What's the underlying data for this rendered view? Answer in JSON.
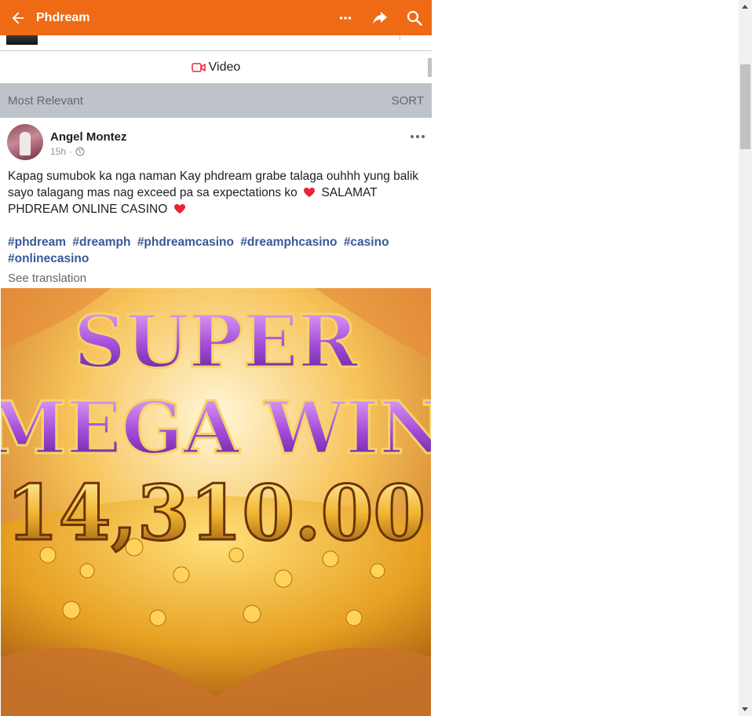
{
  "header": {
    "title": "Phdream"
  },
  "tabs": {
    "video_label": "Video"
  },
  "sort_bar": {
    "left_label": "Most Relevant",
    "right_label": "SORT"
  },
  "post": {
    "author": "Angel Montez",
    "time": "15h",
    "text_line1": "Kapag sumubok ka nga naman  Kay phdream grabe talaga ouhhh yung balik sayo talagang mas nag exceed pa sa expectations ko",
    "text_line2": "SALAMAT PHDREAM ONLINE CASINO",
    "hashtags": [
      "#phdream",
      "#dreamph",
      "#phdreamcasino",
      "#dreamphcasino",
      "#casino",
      "#onlinecasino"
    ],
    "see_translation": "See translation",
    "image_text": {
      "line1": "SUPER",
      "line2": "MEGA WIN",
      "amount": "14,310.00"
    }
  },
  "colors": {
    "brand": "#ee6a15",
    "hashtag": "#385898",
    "heart": "#e8243b"
  }
}
